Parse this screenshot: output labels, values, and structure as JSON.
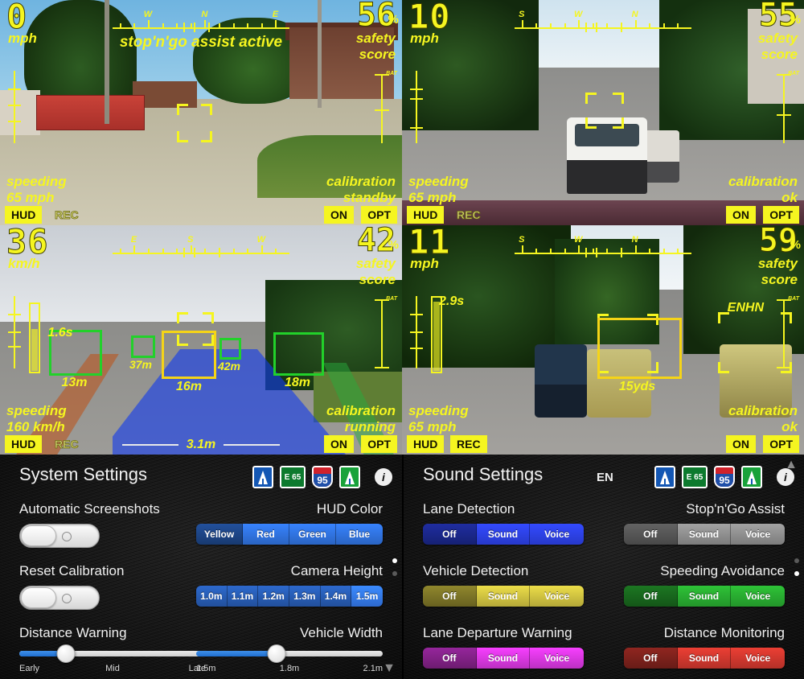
{
  "hud_panels": [
    {
      "id": "panel-village",
      "speed": "0",
      "speed_unit": "mph",
      "score": "56",
      "score_pct": "%",
      "score_label1": "safety",
      "score_label2": "score",
      "message": "stop'n'go assist active",
      "speeding_label": "speeding",
      "speeding_value": "65 mph",
      "calibration_label": "calibration",
      "calibration_status": "standby",
      "compass": [
        "W",
        "N",
        "E"
      ],
      "battery_label": "BAT",
      "buttons": {
        "hud": "HUD",
        "rec": "REC",
        "on": "ON",
        "opt": "OPT"
      },
      "button_states": {
        "hud": "on",
        "rec": "off",
        "on": "on",
        "opt": "on"
      }
    },
    {
      "id": "panel-city",
      "speed": "10",
      "speed_unit": "mph",
      "score": "55",
      "score_pct": "%",
      "score_label1": "safety",
      "score_label2": "score",
      "message": "",
      "speeding_label": "speeding",
      "speeding_value": "65 mph",
      "calibration_label": "calibration",
      "calibration_status": "ok",
      "compass": [
        "S",
        "W",
        "N"
      ],
      "battery_label": "BAT",
      "buttons": {
        "hud": "HUD",
        "rec": "REC",
        "on": "ON",
        "opt": "OPT"
      },
      "button_states": {
        "hud": "on",
        "rec": "off",
        "on": "on",
        "opt": "on"
      }
    },
    {
      "id": "panel-motorway",
      "speed": "36",
      "speed_unit": "km/h",
      "score": "42",
      "score_pct": "%",
      "score_label1": "safety",
      "score_label2": "score",
      "message": "",
      "speeding_label": "speeding",
      "speeding_value": "160 km/h",
      "calibration_label": "calibration",
      "calibration_status": "running",
      "compass": [
        "E",
        "S",
        "W"
      ],
      "battery_label": "BAT",
      "lane_width": "3.1m",
      "buttons": {
        "hud": "HUD",
        "rec": "REC",
        "on": "ON",
        "opt": "OPT"
      },
      "button_states": {
        "hud": "on",
        "rec": "off",
        "on": "on",
        "opt": "on"
      },
      "detections": [
        {
          "label": "13m",
          "ttc": "1.6s",
          "color": "green"
        },
        {
          "label": "37m",
          "color": "green"
        },
        {
          "label": "16m",
          "color": "yellow"
        },
        {
          "label": "42m",
          "color": "green"
        },
        {
          "label": "18m",
          "color": "green"
        }
      ]
    },
    {
      "id": "panel-suburb",
      "speed": "11",
      "speed_unit": "mph",
      "score": "59",
      "score_pct": "%",
      "score_label1": "safety",
      "score_label2": "score",
      "message": "",
      "speeding_label": "speeding",
      "speeding_value": "65 mph",
      "calibration_label": "calibration",
      "calibration_status": "ok",
      "compass": [
        "S",
        "W",
        "N"
      ],
      "battery_label": "BAT",
      "ttc": "2.9s",
      "enhance_label": "ENHN",
      "buttons": {
        "hud": "HUD",
        "rec": "REC",
        "on": "ON",
        "opt": "OPT"
      },
      "button_states": {
        "hud": "on",
        "rec": "on",
        "on": "on",
        "opt": "on"
      },
      "detections": [
        {
          "label": "15yds",
          "color": "yellow"
        }
      ]
    }
  ],
  "system_settings": {
    "title": "System Settings",
    "signs": [
      {
        "name": "motorway-sign-blue",
        "text": ""
      },
      {
        "name": "euro-route-sign",
        "text": "E 65"
      },
      {
        "name": "interstate-shield",
        "text": "95"
      },
      {
        "name": "motorway-sign-green",
        "text": ""
      }
    ],
    "info_label": "i",
    "rows": {
      "automatic_screenshots": {
        "label": "Automatic Screenshots",
        "value": "off"
      },
      "reset_calibration": {
        "label": "Reset Calibration",
        "value": "off"
      },
      "distance_warning": {
        "label": "Distance Warning",
        "ticks": [
          "Early",
          "Mid",
          "Late"
        ],
        "position_pct": 25
      },
      "hud_color": {
        "label": "HUD Color",
        "options": [
          "Yellow",
          "Red",
          "Green",
          "Blue"
        ],
        "selected": "Yellow",
        "accent": "#2f6fd8"
      },
      "camera_height": {
        "label": "Camera Height",
        "options": [
          "1.0m",
          "1.1m",
          "1.2m",
          "1.3m",
          "1.4m",
          "1.5m"
        ],
        "selected": "1.5m",
        "accent": "#2f6fd8"
      },
      "vehicle_width": {
        "label": "Vehicle Width",
        "ticks": [
          "1.5m",
          "1.8m",
          "2.1m"
        ],
        "position_pct": 43
      }
    }
  },
  "sound_settings": {
    "title": "Sound Settings",
    "language": "EN",
    "info_label": "i",
    "rows": [
      {
        "name": "lane-detection",
        "label": "Lane Detection",
        "options": [
          "Off",
          "Sound",
          "Voice"
        ],
        "selected": "Off",
        "accent": "#2b3fe0",
        "side": "left"
      },
      {
        "name": "stop-n-go-assist",
        "label": "Stop'n'Go Assist",
        "options": [
          "Off",
          "Sound",
          "Voice"
        ],
        "selected": "Off",
        "accent": "#8a8a8a",
        "side": "right"
      },
      {
        "name": "vehicle-detection",
        "label": "Vehicle Detection",
        "options": [
          "Off",
          "Sound",
          "Voice"
        ],
        "selected": "Off",
        "accent": "#c8bb3e",
        "side": "left"
      },
      {
        "name": "speeding-avoidance",
        "label": "Speeding Avoidance",
        "options": [
          "Off",
          "Sound",
          "Voice"
        ],
        "selected": "Off",
        "accent": "#27a52f",
        "side": "right"
      },
      {
        "name": "lane-departure-warning",
        "label": "Lane Departure Warning",
        "options": [
          "Off",
          "Sound",
          "Voice"
        ],
        "selected": "Off",
        "accent": "#d135d8",
        "side": "left"
      },
      {
        "name": "distance-monitoring",
        "label": "Distance Monitoring",
        "options": [
          "Off",
          "Sound",
          "Voice"
        ],
        "selected": "Off",
        "accent": "#c8352c",
        "side": "right"
      }
    ]
  },
  "colors": {
    "hud_yellow": "#f5f520",
    "detect_green": "#22d12a",
    "detect_yellow": "#f5d417",
    "lane_blue": "#1448e8",
    "panel_bg": "#151515"
  }
}
